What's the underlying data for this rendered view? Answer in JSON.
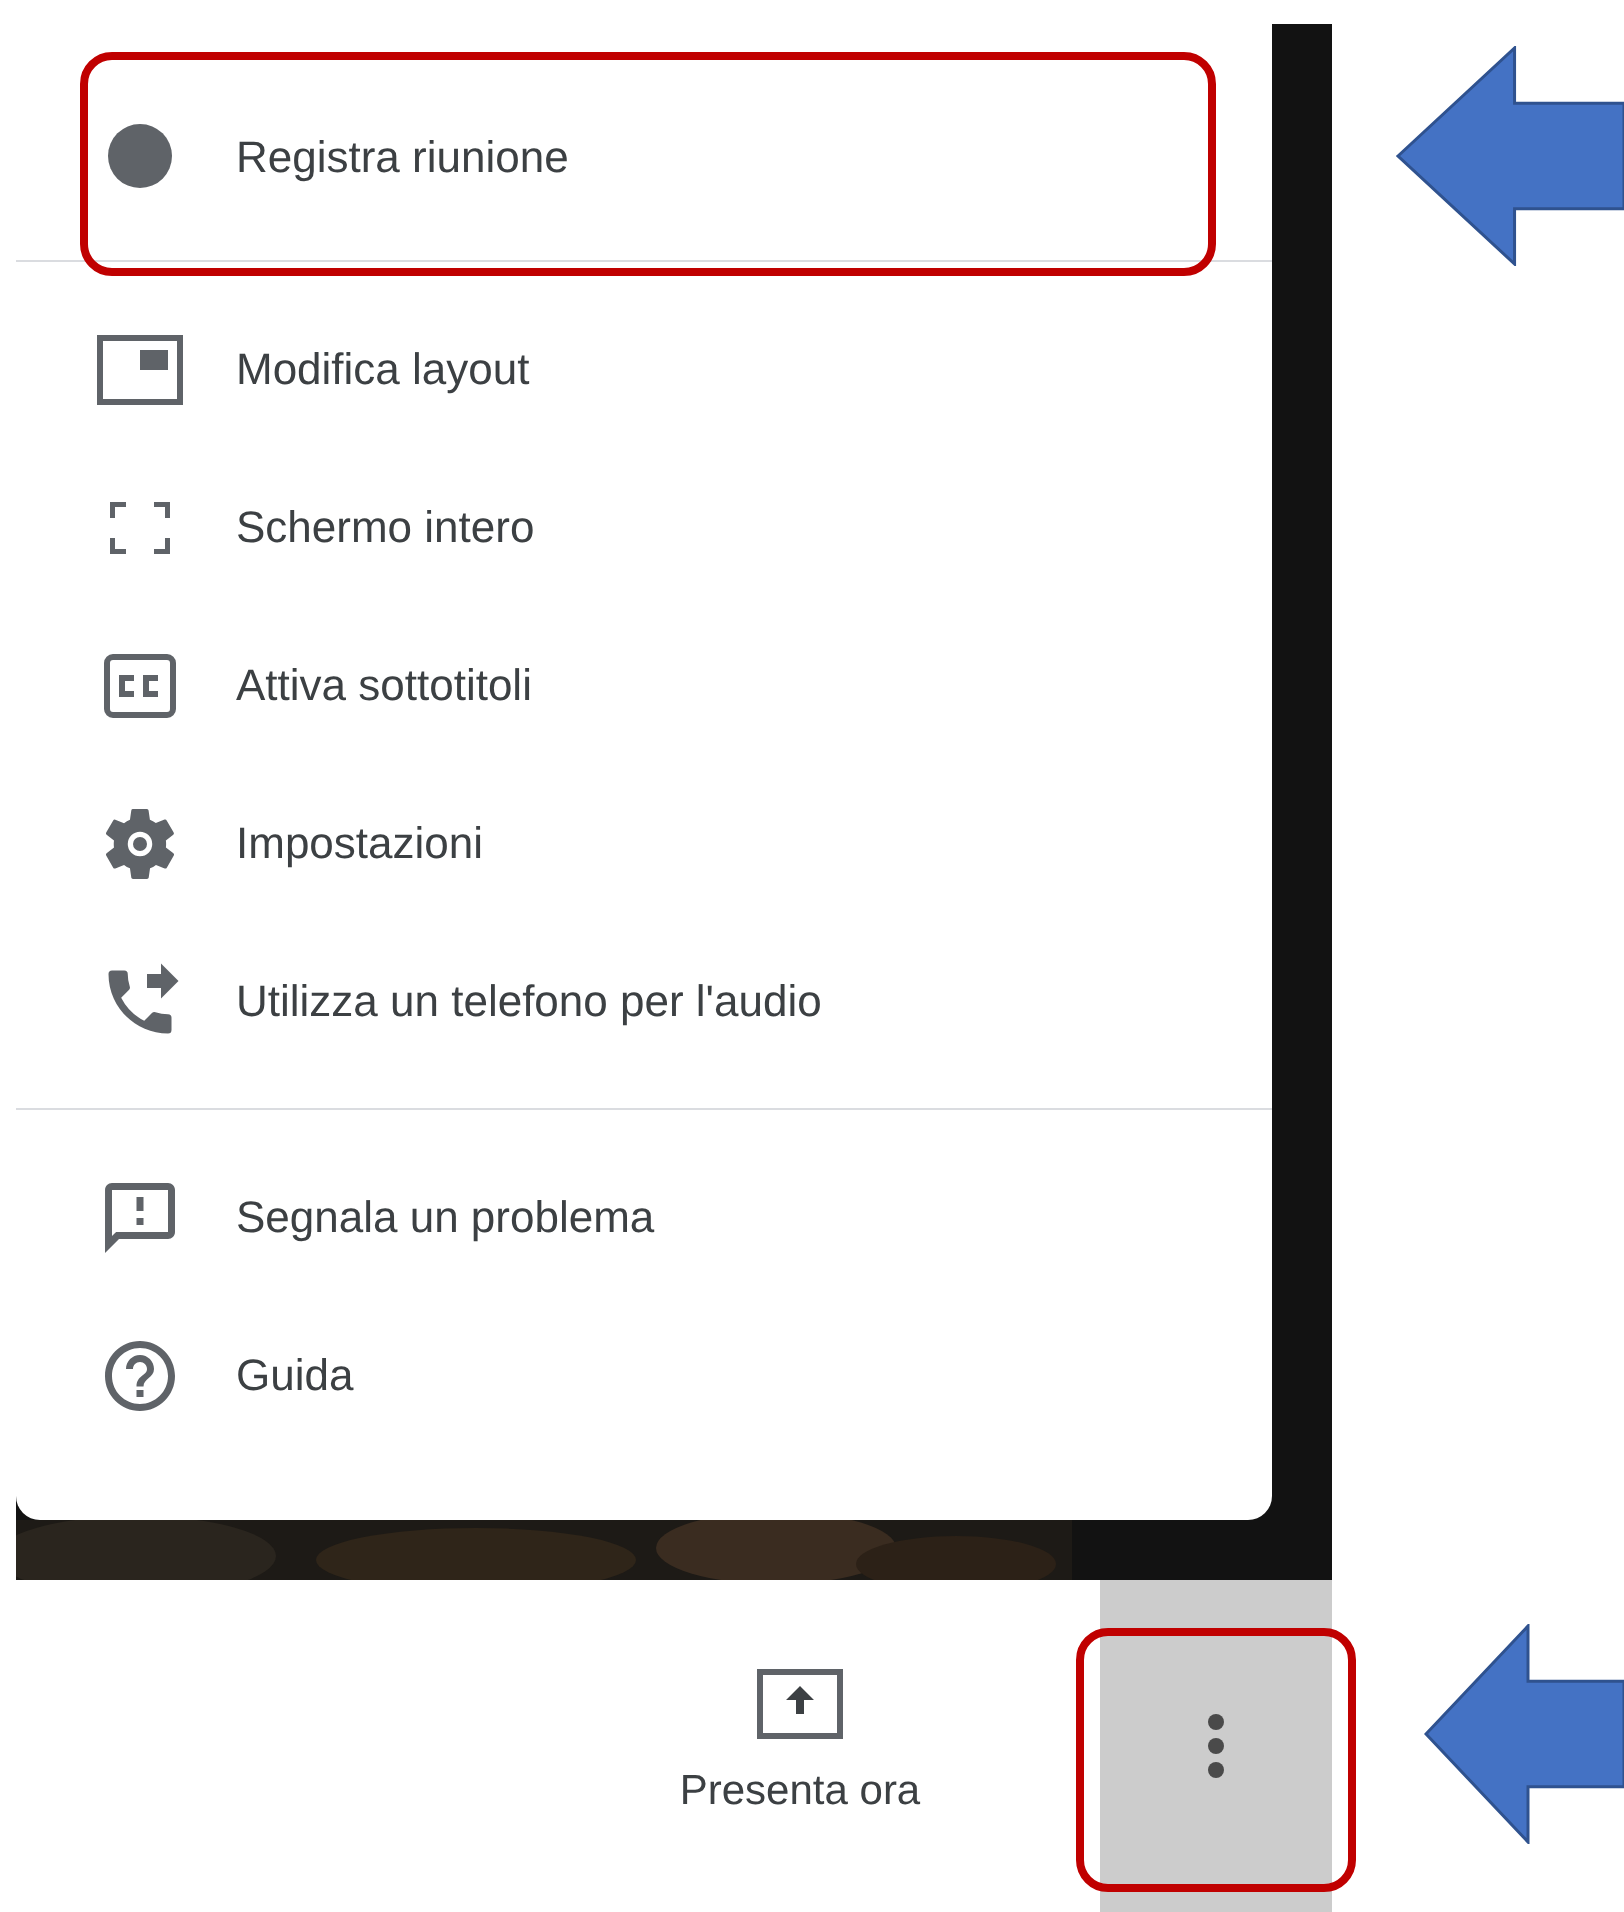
{
  "menu": {
    "groups": [
      {
        "items": [
          {
            "kind": "record",
            "label": "Registra riunione",
            "highlighted": true
          }
        ]
      },
      {
        "items": [
          {
            "kind": "layout",
            "label": "Modifica layout",
            "highlighted": false
          },
          {
            "kind": "fullscreen",
            "label": "Schermo intero",
            "highlighted": false
          },
          {
            "kind": "captions",
            "label": "Attiva sottotitoli",
            "highlighted": false
          },
          {
            "kind": "settings",
            "label": "Impostazioni",
            "highlighted": false
          },
          {
            "kind": "phone",
            "label": "Utilizza un telefono per l'audio",
            "highlighted": false
          }
        ]
      },
      {
        "items": [
          {
            "kind": "report",
            "label": "Segnala un problema",
            "highlighted": false
          },
          {
            "kind": "help",
            "label": "Guida",
            "highlighted": false
          }
        ]
      }
    ]
  },
  "toolbar": {
    "present_button": {
      "label": "Presenta ora"
    },
    "more_button": {
      "highlighted": true
    }
  }
}
